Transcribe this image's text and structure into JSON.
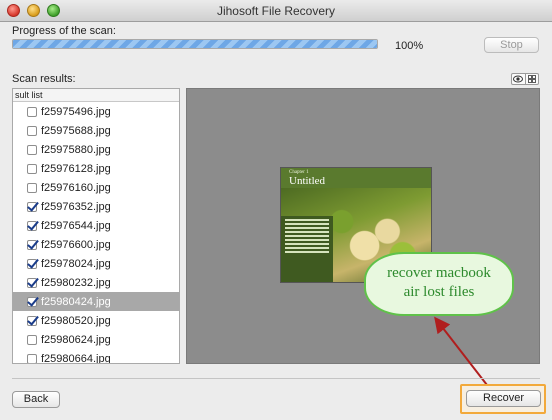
{
  "window": {
    "title": "Jihosoft File Recovery"
  },
  "scan": {
    "progress_label": "Progress of the scan:",
    "progress_fraction": 1.0,
    "progress_text": "100%",
    "stop_label": "Stop"
  },
  "results": {
    "label": "Scan results:",
    "list_header": "sult list",
    "files": [
      {
        "name": "f25975496.jpg",
        "checked": false,
        "selected": false
      },
      {
        "name": "f25975688.jpg",
        "checked": false,
        "selected": false
      },
      {
        "name": "f25975880.jpg",
        "checked": false,
        "selected": false
      },
      {
        "name": "f25976128.jpg",
        "checked": false,
        "selected": false
      },
      {
        "name": "f25976160.jpg",
        "checked": false,
        "selected": false
      },
      {
        "name": "f25976352.jpg",
        "checked": true,
        "selected": false
      },
      {
        "name": "f25976544.jpg",
        "checked": true,
        "selected": false
      },
      {
        "name": "f25976600.jpg",
        "checked": true,
        "selected": false
      },
      {
        "name": "f25978024.jpg",
        "checked": true,
        "selected": false
      },
      {
        "name": "f25980232.jpg",
        "checked": true,
        "selected": false
      },
      {
        "name": "f25980424.jpg",
        "checked": true,
        "selected": true
      },
      {
        "name": "f25980520.jpg",
        "checked": true,
        "selected": false
      },
      {
        "name": "f25980624.jpg",
        "checked": false,
        "selected": false
      },
      {
        "name": "f25980664.jpg",
        "checked": false,
        "selected": false
      }
    ]
  },
  "preview": {
    "doc_chapter": "Chapter 1",
    "doc_title": "Untitled"
  },
  "callout": {
    "line1": "recover macbook",
    "line2": "air lost files"
  },
  "footer": {
    "back_label": "Back",
    "recover_label": "Recover"
  },
  "colors": {
    "callout_border": "#5fc249",
    "callout_text": "#2d8a2d",
    "highlight_frame": "#f2a93b",
    "arrow": "#b01e1e",
    "selected_row": "#a8a8a8"
  },
  "icons": {
    "view_toggle": [
      "eye-icon",
      "grid-icon"
    ]
  }
}
